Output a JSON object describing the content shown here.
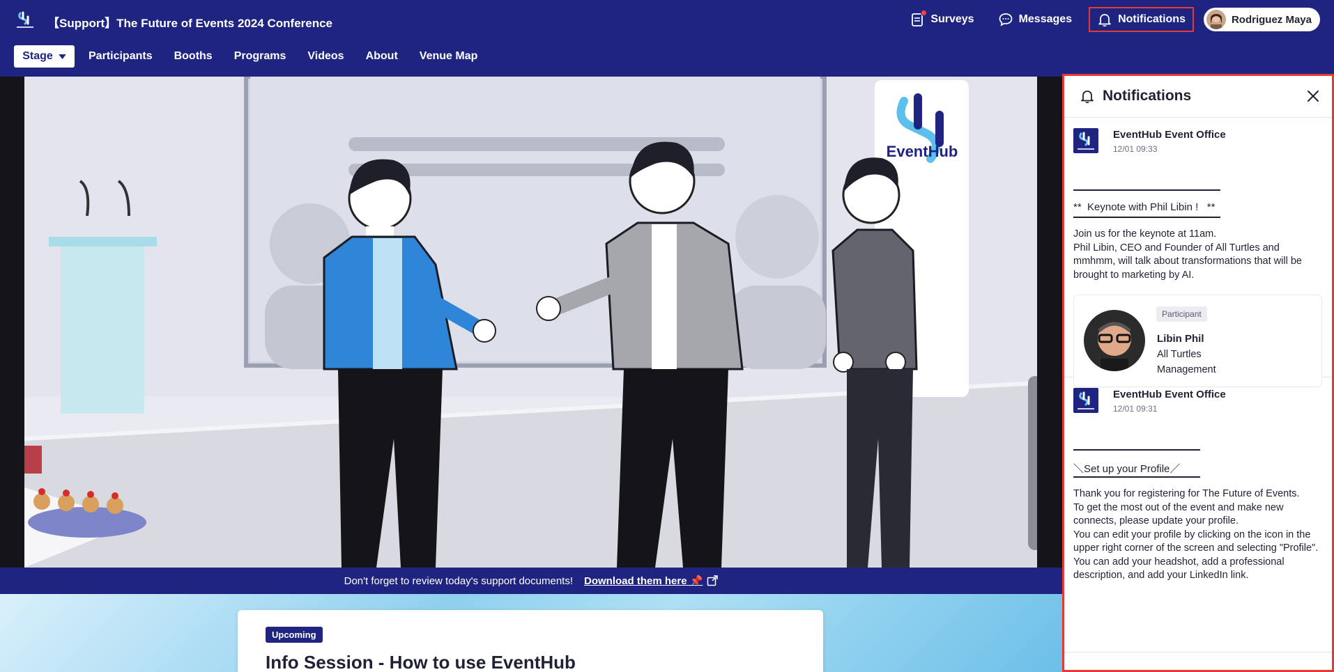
{
  "app": {
    "title": "【Support】The Future of Events 2024 Conference"
  },
  "topbar": {
    "surveys_label": "Surveys",
    "messages_label": "Messages",
    "notifications_label": "Notifications",
    "user_name": "Rodriguez Maya"
  },
  "nav": {
    "stage_label": "Stage",
    "items": [
      {
        "label": "Participants"
      },
      {
        "label": "Booths"
      },
      {
        "label": "Programs"
      },
      {
        "label": "Videos"
      },
      {
        "label": "About"
      },
      {
        "label": "Venue Map"
      }
    ]
  },
  "video": {
    "brand": "EventHub"
  },
  "banner": {
    "text": "Don't forget to review today's support documents!",
    "link": "Download them here 📌"
  },
  "session": {
    "badge": "Upcoming",
    "title": "Info Session - How to use EventHub"
  },
  "notifications": {
    "title": "Notifications",
    "items": [
      {
        "sender": "EventHub Event Office",
        "time": "12/01 09:33",
        "heading": "**  Keynote with Phil Libin !   **",
        "body": [
          "Join us for the keynote at 11am.",
          "Phil Libin, CEO and Founder of All Turtles and",
          "mmhmm, will talk about transformations that will be",
          "brought to marketing by AI."
        ],
        "participant": {
          "role": "Participant",
          "name": "Libin Phil",
          "company": "All Turtles",
          "title": "Management"
        }
      },
      {
        "sender": "EventHub Event Office",
        "time": "12/01 09:31",
        "heading": "＼Set up your Profile／",
        "body": [
          "Thank you for registering for The Future of Events.",
          "To get the most out of the event and make new",
          "connects, please update your profile.",
          "You can edit your profile by clicking on the icon in the",
          "upper right corner of the screen and selecting \"Profile\".",
          "You can add your headshot, add a professional",
          "description, and add your LinkedIn link."
        ]
      }
    ]
  },
  "colors": {
    "brand_navy": "#1e2480",
    "highlight_red": "#e53935",
    "notification_dot": "#f0453a"
  }
}
